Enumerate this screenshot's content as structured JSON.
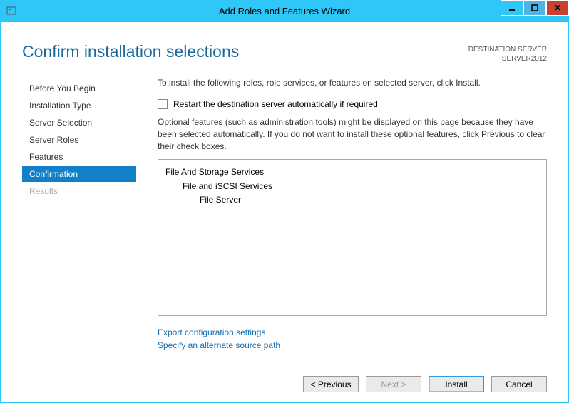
{
  "titlebar": {
    "title": "Add Roles and Features Wizard"
  },
  "header": {
    "title": "Confirm installation selections",
    "dest_label": "DESTINATION SERVER",
    "dest_server": "SERVER2012"
  },
  "sidebar": {
    "items": [
      {
        "label": "Before You Begin",
        "state": "normal"
      },
      {
        "label": "Installation Type",
        "state": "normal"
      },
      {
        "label": "Server Selection",
        "state": "normal"
      },
      {
        "label": "Server Roles",
        "state": "normal"
      },
      {
        "label": "Features",
        "state": "normal"
      },
      {
        "label": "Confirmation",
        "state": "active"
      },
      {
        "label": "Results",
        "state": "disabled"
      }
    ]
  },
  "content": {
    "intro": "To install the following roles, role services, or features on selected server, click Install.",
    "restart_label": "Restart the destination server automatically if required",
    "optional_text": "Optional features (such as administration tools) might be displayed on this page because they have been selected automatically. If you do not want to install these optional features, click Previous to clear their check boxes.",
    "roles": [
      {
        "label": "File And Storage Services",
        "indent": 0
      },
      {
        "label": "File and iSCSI Services",
        "indent": 1
      },
      {
        "label": "File Server",
        "indent": 2
      }
    ],
    "link_export": "Export configuration settings",
    "link_altpath": "Specify an alternate source path"
  },
  "buttons": {
    "previous": "< Previous",
    "next": "Next >",
    "install": "Install",
    "cancel": "Cancel"
  }
}
